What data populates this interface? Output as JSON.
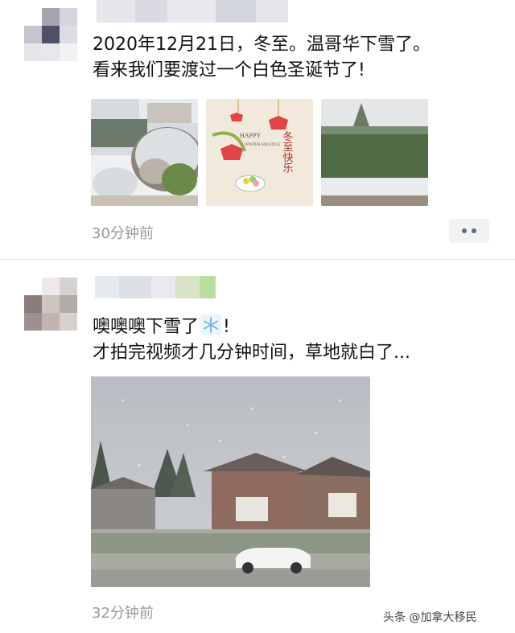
{
  "posts": [
    {
      "text_line1": "2020年12月21日，冬至。温哥华下雪了。",
      "text_line2": "看来我们要渡过一个白色圣诞节了!",
      "time": "30分钟前",
      "photos": [
        {
          "icon": "snowy-garden-photo"
        },
        {
          "icon": "winter-solstice-card-photo",
          "card_text": "HAPPY",
          "card_text_sub": "WINTER SOLSTICE",
          "card_text_cn": "冬至快乐"
        },
        {
          "icon": "snowy-hedge-photo"
        }
      ]
    },
    {
      "text_line1_before": "噢噢噢下雪了",
      "text_line1_after": "!",
      "text_line2": "才拍完视频才几分钟时间，草地就白了...",
      "time": "32分钟前",
      "photo": {
        "icon": "snowy-street-houses-photo"
      }
    }
  ],
  "watermark": "头条 @加拿大移民",
  "colors": {
    "time": "#9a9a9a",
    "more_dots": "#5a6a8a"
  }
}
